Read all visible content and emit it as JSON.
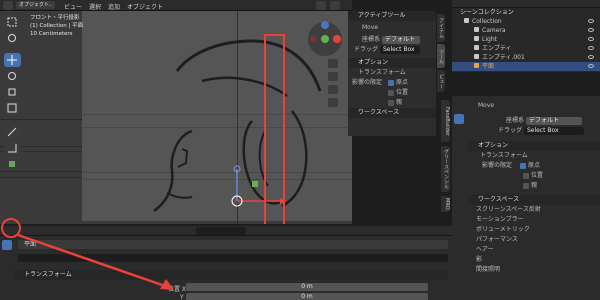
{
  "top_header": {
    "editor_menu": "オブジェクト..",
    "menus": [
      "ビュー",
      "選択",
      "追加",
      "オブジェクト"
    ]
  },
  "viewport": {
    "view_name": "フロント・平行投影",
    "collection_line": "(1) Collection | 平面",
    "scale_text": "10 Centimeters"
  },
  "n_panel": {
    "section_active_tool": "アクティブツール",
    "tool_name": "Move",
    "orientation_label": "座標系",
    "orientation_value": "デフォルト",
    "drag_label": "ドラッグ",
    "drag_value": "Select Box",
    "section_options": "オプション",
    "section_transform": "トランスフォーム",
    "affect_only_label": "影響の限定",
    "affect_origins": "原点",
    "affect_locations": "位置",
    "affect_parents": "親",
    "section_workspace": "ワークスペース",
    "tab_item": "アイテム",
    "tab_tool": "ツール",
    "tab_view": "ビュー"
  },
  "outliner": {
    "header": "シーンコレクション",
    "items": [
      {
        "name": "Collection",
        "color": "#c8c8c8"
      },
      {
        "name": "Camera",
        "color": "#c8c8c8"
      },
      {
        "name": "Light",
        "color": "#c8c8c8"
      },
      {
        "name": "エンプティ",
        "color": "#c8c8c8"
      },
      {
        "name": "エンプティ.001",
        "color": "#c8c8c8"
      },
      {
        "name": "平面",
        "color": "#e6a050"
      }
    ]
  },
  "properties": {
    "tool_name": "Move",
    "orientation_label": "座標系",
    "orientation_value": "デフォルト",
    "drag_label": "ドラッグ",
    "drag_value": "Select Box",
    "section_options": "オプション",
    "section_transform": "トランスフォーム",
    "affect_only_label": "影響の限定",
    "affect_origins": "原点",
    "affect_locations": "位置",
    "affect_parents": "親",
    "section_workspace": "ワークスペース",
    "workspace_items": [
      "スクリーンスペース反射",
      "モーションブラー",
      "ボリューメトリック",
      "パフォーマンス",
      "ヘアー",
      "影",
      "間接照明"
    ],
    "side_tabs": [
      "FaceBuilder",
      "グリースペンシル",
      "MRO"
    ]
  },
  "bottom_props": {
    "object_name": "平面",
    "transform_label": "トランスフォーム",
    "location_x_label": "位置 X",
    "location_y_label": "Y",
    "location_x_value": "0 m",
    "location_y_value": "0 m"
  },
  "colors": {
    "accent": "#4772b3",
    "annotation_red": "#e8423a",
    "header": "#2b2b2b"
  }
}
